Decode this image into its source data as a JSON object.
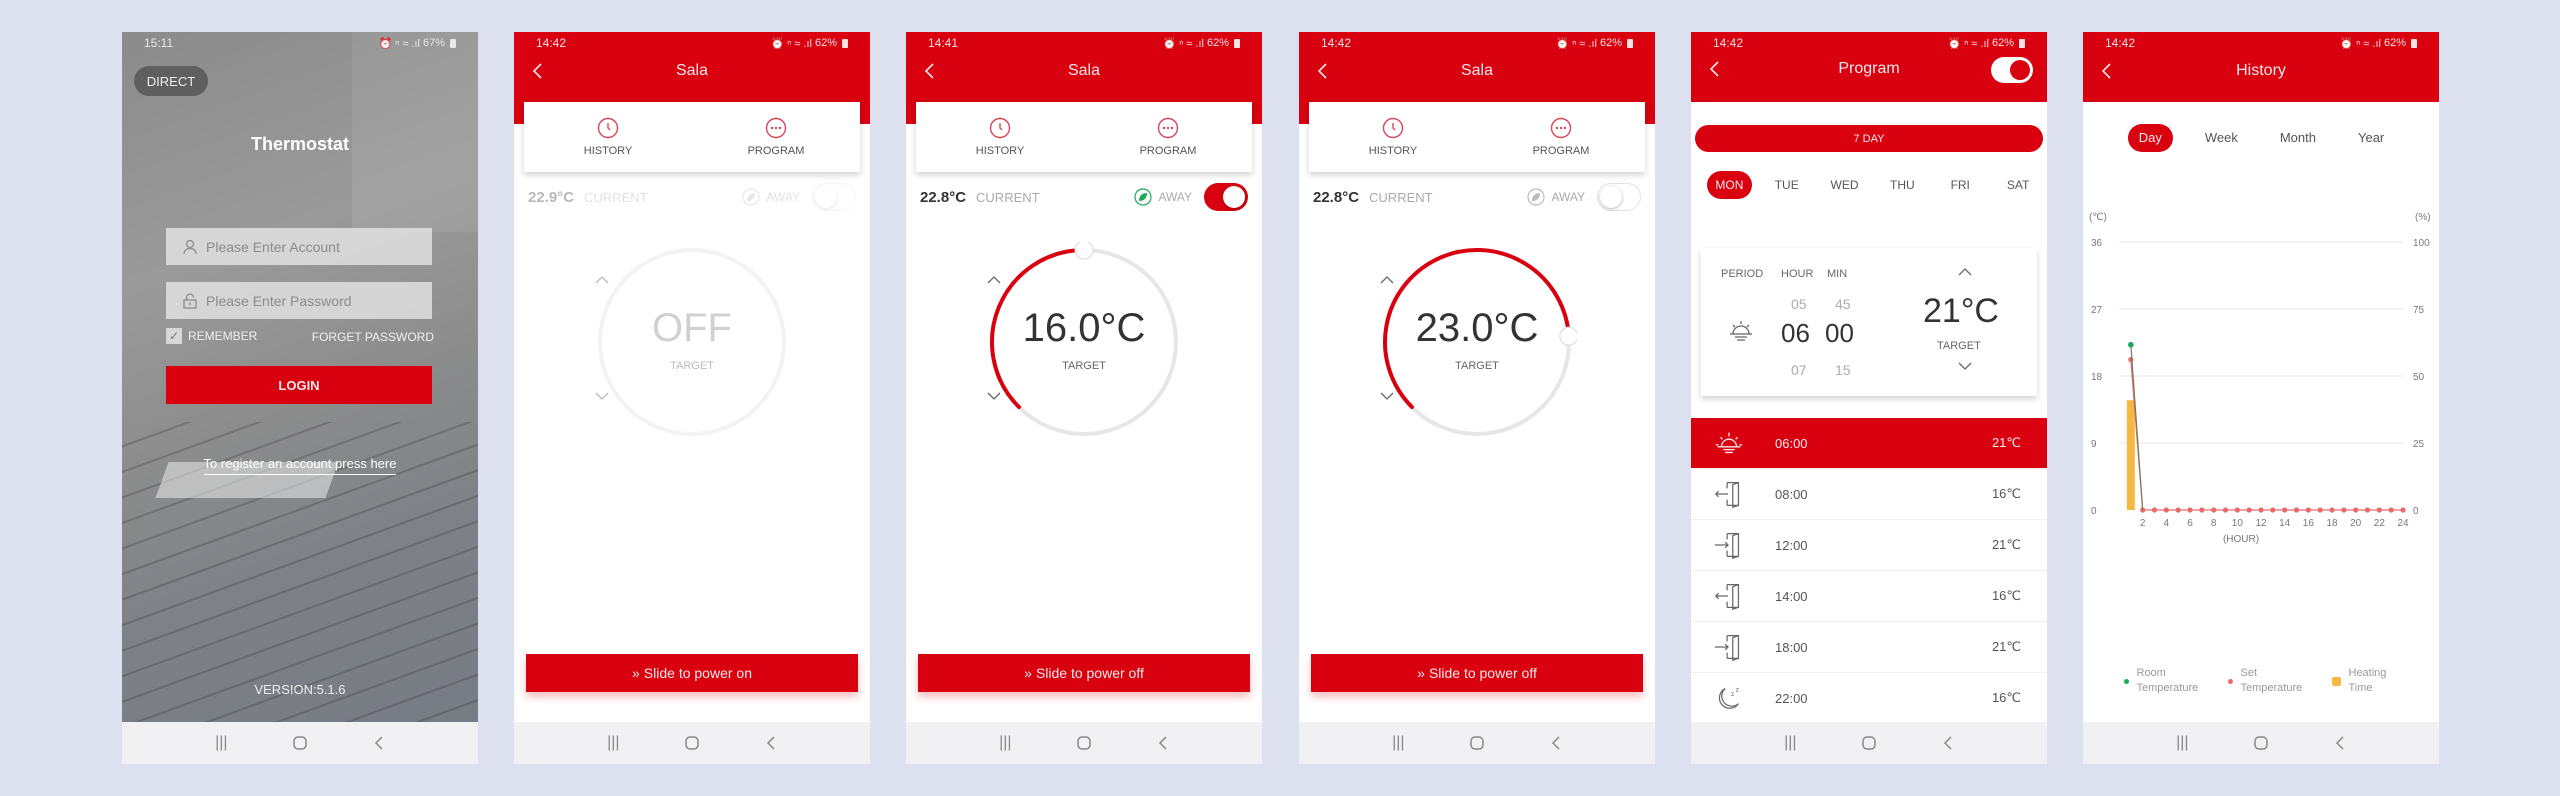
{
  "colors": {
    "brand_red": "#d9000f",
    "room_temp": "#1aaa5a",
    "set_temp": "#e86a6a",
    "heating": "#f5b942",
    "background": "#dde0ee"
  },
  "screens": {
    "login": {
      "status": {
        "time": "15:11",
        "battery": "67%"
      },
      "direct_label": "DIRECT",
      "title": "Thermostat",
      "account_placeholder": "Please Enter Account",
      "password_placeholder": "Please Enter Password",
      "remember_label": "REMEMBER",
      "remember_checked": true,
      "forget_label": "FORGET PASSWORD",
      "login_label": "LOGIN",
      "register_label": "To register an account press here",
      "version": "VERSION:5.1.6"
    },
    "device_off": {
      "status": {
        "time": "14:42",
        "battery": "62%"
      },
      "title": "Sala",
      "tabs": [
        {
          "label": "HISTORY",
          "icon": "clock-icon"
        },
        {
          "label": "PROGRAM",
          "icon": "more-icon"
        }
      ],
      "current_temp": "22.9°C",
      "current_label": "CURRENT",
      "away_label": "AWAY",
      "away_on": false,
      "target_value": "OFF",
      "target_label": "TARGET",
      "slide_label": "Slide to power on"
    },
    "device_away": {
      "status": {
        "time": "14:41",
        "battery": "62%"
      },
      "title": "Sala",
      "tabs": [
        {
          "label": "HISTORY",
          "icon": "clock-icon"
        },
        {
          "label": "PROGRAM",
          "icon": "more-icon"
        }
      ],
      "current_temp": "22.8°C",
      "current_label": "CURRENT",
      "away_label": "AWAY",
      "away_on": true,
      "target_value": "16.0°C",
      "target_label": "TARGET",
      "dial_fraction": 0.5,
      "slide_label": "Slide to power off"
    },
    "device_on": {
      "status": {
        "time": "14:42",
        "battery": "62%"
      },
      "title": "Sala",
      "tabs": [
        {
          "label": "HISTORY",
          "icon": "clock-icon"
        },
        {
          "label": "PROGRAM",
          "icon": "more-icon"
        }
      ],
      "current_temp": "22.8°C",
      "current_label": "CURRENT",
      "away_label": "AWAY",
      "away_on": false,
      "target_value": "23.0°C",
      "target_label": "TARGET",
      "dial_fraction": 0.82,
      "slide_label": "Slide to power off"
    },
    "program": {
      "status": {
        "time": "14:42",
        "battery": "62%"
      },
      "title": "Program",
      "program_enabled": true,
      "mode_label": "7 DAY",
      "days": [
        "MON",
        "TUE",
        "WED",
        "THU",
        "FRI",
        "SAT"
      ],
      "active_day": "MON",
      "picker": {
        "period_label": "PERIOD",
        "hour_label": "HOUR",
        "min_label": "MIN",
        "hour_prev": "05",
        "hour": "06",
        "hour_next": "07",
        "min_prev": "45",
        "min": "00",
        "min_next": "15",
        "target": "21°C",
        "target_label": "TARGET"
      },
      "schedule": [
        {
          "icon": "sunrise-icon",
          "time": "06:00",
          "temp": "21℃",
          "active": true
        },
        {
          "icon": "leave-home-icon",
          "time": "08:00",
          "temp": "16℃",
          "active": false
        },
        {
          "icon": "return-home-icon",
          "time": "12:00",
          "temp": "21℃",
          "active": false
        },
        {
          "icon": "leave-home-icon",
          "time": "14:00",
          "temp": "16℃",
          "active": false
        },
        {
          "icon": "return-home-icon",
          "time": "18:00",
          "temp": "21℃",
          "active": false
        },
        {
          "icon": "sleep-moon-icon",
          "time": "22:00",
          "temp": "16℃",
          "active": false
        }
      ]
    },
    "history": {
      "status": {
        "time": "14:42",
        "battery": "62%"
      },
      "title": "History",
      "periods": [
        "Day",
        "Week",
        "Month",
        "Year"
      ],
      "active_period": "Day",
      "legend": [
        "Room Temperature",
        "Set Temperature",
        "Heating Time"
      ]
    }
  },
  "chart_data": {
    "type": "line",
    "title": "History - Day",
    "xlabel": "(HOUR)",
    "ylabel": "(℃)",
    "y2label": "(%)",
    "x_ticks": [
      2,
      4,
      6,
      8,
      10,
      12,
      14,
      16,
      18,
      20,
      22,
      24
    ],
    "y_ticks": [
      0,
      9,
      18,
      27,
      36
    ],
    "y2_ticks": [
      0,
      25,
      50,
      75,
      100
    ],
    "ylim": [
      0,
      36
    ],
    "y2lim": [
      0,
      100
    ],
    "xlim": [
      0,
      24
    ],
    "grid": true,
    "legend_position": "bottom",
    "series": [
      {
        "name": "Room Temperature",
        "axis": "left",
        "x": [
          1
        ],
        "values": [
          22.2
        ]
      },
      {
        "name": "Set Temperature",
        "axis": "left",
        "x": [
          1,
          2,
          3,
          4,
          5,
          6,
          7,
          8,
          9,
          10,
          11,
          12,
          13,
          14,
          15,
          16,
          17,
          18,
          19,
          20,
          21,
          22,
          23,
          24
        ],
        "values": [
          20.2,
          0,
          0,
          0,
          0,
          0,
          0,
          0,
          0,
          0,
          0,
          0,
          0,
          0,
          0,
          0,
          0,
          0,
          0,
          0,
          0,
          0,
          0,
          0
        ]
      },
      {
        "name": "Heating Time",
        "axis": "right",
        "type": "bar",
        "x": [
          1
        ],
        "values": [
          41
        ]
      }
    ]
  }
}
